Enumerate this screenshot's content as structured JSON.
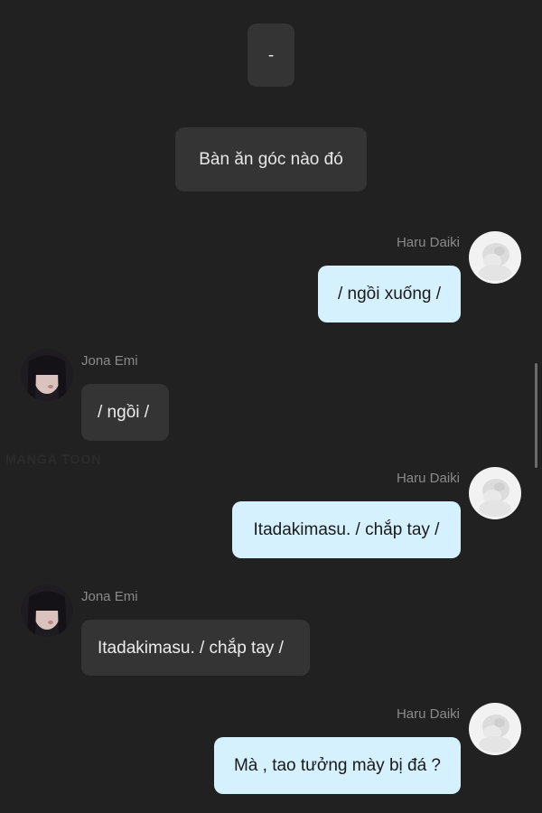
{
  "messages": [
    {
      "type": "system",
      "text": "-"
    },
    {
      "type": "system",
      "text": "Bàn ăn góc nào đó"
    },
    {
      "type": "right",
      "sender": "Haru Daiki",
      "text": "/ ngồi xuống /"
    },
    {
      "type": "left",
      "sender": "Jona Emi",
      "text": "/ ngồi /"
    },
    {
      "type": "right",
      "sender": "Haru Daiki",
      "text": "Itadakimasu. / chắp tay /"
    },
    {
      "type": "left",
      "sender": "Jona Emi",
      "text": "Itadakimasu. / chắp tay /"
    },
    {
      "type": "right",
      "sender": "Haru Daiki",
      "text": "Mà , tao tưởng mày bị đá ?"
    }
  ],
  "watermark": "MANGA TOON",
  "colors": {
    "background": "#212121",
    "left_bubble": "#343434",
    "right_bubble": "#d5f1fd",
    "name_text": "#8a8a8a"
  },
  "icons": {
    "haru_avatar": "avatar-haru-daiki",
    "jona_avatar": "avatar-jona-emi"
  }
}
